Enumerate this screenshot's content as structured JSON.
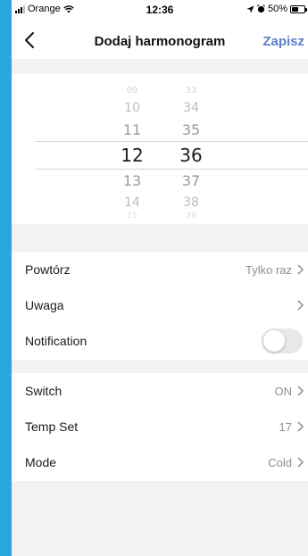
{
  "status_bar": {
    "carrier": "Orange",
    "time": "12:36",
    "battery": "50%",
    "battery_level": 0.5
  },
  "nav": {
    "title": "Dodaj harmonogram",
    "save_label": "Zapisz"
  },
  "time_picker": {
    "hours": [
      "09",
      "10",
      "11",
      "12",
      "13",
      "14",
      "15"
    ],
    "minutes": [
      "33",
      "34",
      "35",
      "36",
      "37",
      "38",
      "39"
    ],
    "selected_hour": "12",
    "selected_minute": "36"
  },
  "settings": {
    "repeat": {
      "label": "Powtórz",
      "value": "Tylko raz"
    },
    "note": {
      "label": "Uwaga"
    },
    "notification": {
      "label": "Notification",
      "enabled": false
    },
    "switch": {
      "label": "Switch",
      "value": "ON"
    },
    "temp_set": {
      "label": "Temp Set",
      "value": "17"
    },
    "mode": {
      "label": "Mode",
      "value": "Cold"
    }
  },
  "colors": {
    "accent": "#5b7fc7",
    "frame": "#29a8df",
    "background": "#f2f2f4"
  }
}
